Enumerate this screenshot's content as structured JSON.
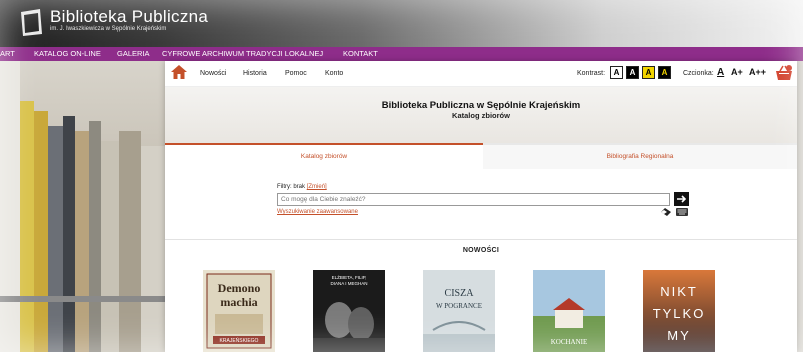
{
  "brand": {
    "title": "Biblioteka Publiczna",
    "subtitle": "im. J. Iwaszkiewicza w Sępólnie Krajeńskim"
  },
  "topnav": {
    "items": [
      "ART",
      "KATALOG ON-LINE",
      "GALERIA",
      "CYFROWE ARCHIWUM TRADYCJI LOKALNEJ",
      "KONTAKT"
    ]
  },
  "subnav": {
    "links": [
      "Nowości",
      "Historia",
      "Pomoc",
      "Konto"
    ],
    "contrast_label": "Kontrast:",
    "contrast_options": [
      "A",
      "A",
      "A",
      "A"
    ],
    "font_label": "Czcionka:",
    "font_options": [
      "A",
      "A+",
      "A++"
    ]
  },
  "hero": {
    "title": "Biblioteka Publiczna w Sępólnie Krajeńskim",
    "subtitle": "Katalog zbiorów"
  },
  "tabs": [
    "Katalog zbiorów",
    "Bibliografia Regionalna"
  ],
  "search": {
    "filters_label": "Filtry: brak",
    "filters_change": "[Zmień]",
    "placeholder": "Co mogę dla Ciebie znaleźć?",
    "advanced_label": "Wyszukiwanie zaawansowane"
  },
  "news": {
    "title": "NOWOŚCI",
    "covers": [
      {
        "text1": "Demono",
        "text2": "machia",
        "text3": "KRAJEŃSKIEGO"
      },
      {
        "text1": "ELŻBIETA, FILIP,",
        "text2": "DIANA I MEGHAN"
      },
      {
        "text1": "CISZA",
        "text2": "W POGRANCE"
      },
      {
        "text1": "",
        "text2": "KOCHANIE"
      },
      {
        "text1": "NIKT",
        "text2": "TYLKO",
        "text3": "MY"
      }
    ]
  },
  "colors": {
    "accent": "#8e2d8a",
    "link": "#c4502a",
    "home_icon": "#c4502a",
    "basket_icon": "#d23f2a"
  },
  "icons": {
    "home": "home-icon",
    "basket": "basket-icon",
    "search_submit": "arrow-right-icon",
    "eraser": "eraser-icon",
    "keyboard": "keyboard-icon"
  }
}
